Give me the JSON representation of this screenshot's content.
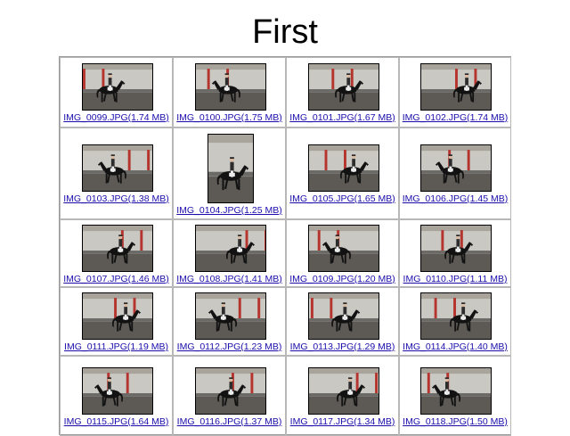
{
  "page": {
    "title": "First"
  },
  "images": [
    {
      "label": "IMG_0099.JPG(1.74 MB)",
      "orientation": "landscape"
    },
    {
      "label": "IMG_0100.JPG(1.75 MB)",
      "orientation": "landscape"
    },
    {
      "label": "IMG_0101.JPG(1.67 MB)",
      "orientation": "landscape"
    },
    {
      "label": "IMG_0102.JPG(1.74 MB)",
      "orientation": "landscape"
    },
    {
      "label": "IMG_0103.JPG(1.38 MB)",
      "orientation": "landscape"
    },
    {
      "label": "IMG_0104.JPG(1.25 MB)",
      "orientation": "portrait"
    },
    {
      "label": "IMG_0105.JPG(1.65 MB)",
      "orientation": "landscape"
    },
    {
      "label": "IMG_0106.JPG(1.45 MB)",
      "orientation": "landscape"
    },
    {
      "label": "IMG_0107.JPG(1.46 MB)",
      "orientation": "landscape"
    },
    {
      "label": "IMG_0108.JPG(1.41 MB)",
      "orientation": "landscape"
    },
    {
      "label": "IMG_0109.JPG(1.20 MB)",
      "orientation": "landscape"
    },
    {
      "label": "IMG_0110.JPG(1.11 MB)",
      "orientation": "landscape"
    },
    {
      "label": "IMG_0111.JPG(1.19 MB)",
      "orientation": "landscape"
    },
    {
      "label": "IMG_0112.JPG(1.23 MB)",
      "orientation": "landscape"
    },
    {
      "label": "IMG_0113.JPG(1.29 MB)",
      "orientation": "landscape"
    },
    {
      "label": "IMG_0114.JPG(1.40 MB)",
      "orientation": "landscape"
    },
    {
      "label": "IMG_0115.JPG(1.64 MB)",
      "orientation": "landscape"
    },
    {
      "label": "IMG_0116.JPG(1.37 MB)",
      "orientation": "landscape"
    },
    {
      "label": "IMG_0117.JPG(1.34 MB)",
      "orientation": "landscape"
    },
    {
      "label": "IMG_0118.JPG(1.50 MB)",
      "orientation": "landscape"
    }
  ],
  "colors": {
    "link": "#1a0dab",
    "cell_border": "#b8b8b8"
  }
}
